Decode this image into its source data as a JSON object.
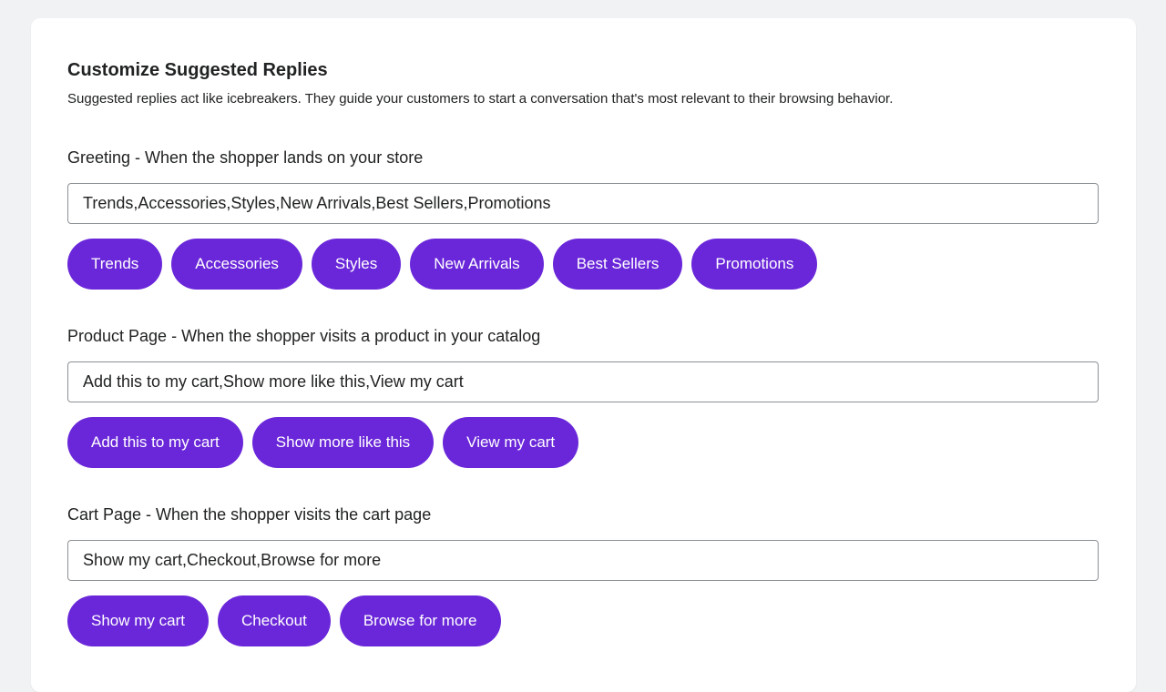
{
  "header": {
    "title": "Customize Suggested Replies",
    "subtitle": "Suggested replies act like icebreakers. They guide your customers to start a conversation that's most relevant to their browsing behavior."
  },
  "colors": {
    "accent": "#6a27d9",
    "background": "#f1f2f4",
    "card": "#ffffff"
  },
  "sections": [
    {
      "label": "Greeting - When the shopper lands on your store",
      "input_value": "Trends,Accessories,Styles,New Arrivals,Best Sellers,Promotions",
      "chips": [
        "Trends",
        "Accessories",
        "Styles",
        "New Arrivals",
        "Best Sellers",
        "Promotions"
      ]
    },
    {
      "label": "Product Page - When the shopper visits a product in your catalog",
      "input_value": "Add this to my cart,Show more like this,View my cart",
      "chips": [
        "Add this to my cart",
        "Show more like this",
        "View my cart"
      ]
    },
    {
      "label": "Cart Page - When the shopper visits the cart page",
      "input_value": "Show my cart,Checkout,Browse for more",
      "chips": [
        "Show my cart",
        "Checkout",
        "Browse for more"
      ]
    }
  ]
}
